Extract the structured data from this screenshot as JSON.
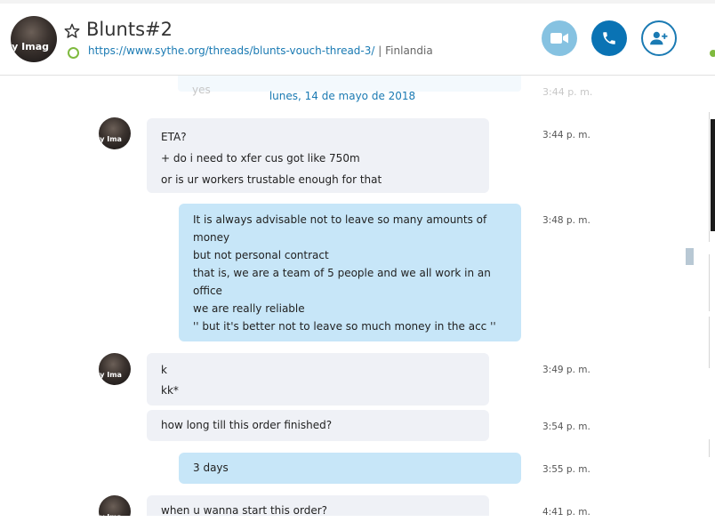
{
  "header": {
    "contact_name": "Blunts#2",
    "status_url": "https://www.sythe.org/threads/blunts-vouch-thread-3/",
    "separator": "|",
    "location": "Finlandia",
    "avatar_text": "yy Imag",
    "status_color": "#7fba3f",
    "buttons": {
      "video_icon": "video-camera-icon",
      "call_icon": "phone-icon",
      "add_icon": "add-person-icon"
    }
  },
  "conversation": {
    "ghost": {
      "text": "yes",
      "time": "3:44 p. m."
    },
    "date_divider": "lunes, 14 de mayo de 2018",
    "avatar_text": "yy Ima",
    "messages": [
      {
        "from": "contact",
        "lines": [
          "ETA?",
          "+ do i need to xfer cus got like 750m",
          "or is ur workers trustable enough for that"
        ],
        "time": "3:44 p. m."
      },
      {
        "from": "me",
        "lines": [
          "It is always advisable not to leave so many amounts of",
          "money",
          "but not personal contract",
          "that is, we are a team of 5 people and we all work in an",
          "office",
          "we are really reliable",
          "'' but it's better not to leave so much money in the acc ''"
        ],
        "time": "3:48 p. m."
      },
      {
        "from": "contact",
        "lines": [
          "k",
          "kk*"
        ],
        "time": "3:49 p. m."
      },
      {
        "from": "contact",
        "lines": [
          "how long till this order finished?"
        ],
        "time": "3:54 p. m."
      },
      {
        "from": "me",
        "lines": [
          "3 days"
        ],
        "time": "3:55 p. m."
      },
      {
        "from": "contact",
        "lines": [
          "when u wanna start this order?"
        ],
        "time": "4:41 p. m."
      }
    ]
  },
  "colors": {
    "accent": "#0a73b4",
    "incoming_bubble": "#eff1f6",
    "outgoing_bubble": "#c7e6f8",
    "link": "#1a7ab3"
  }
}
